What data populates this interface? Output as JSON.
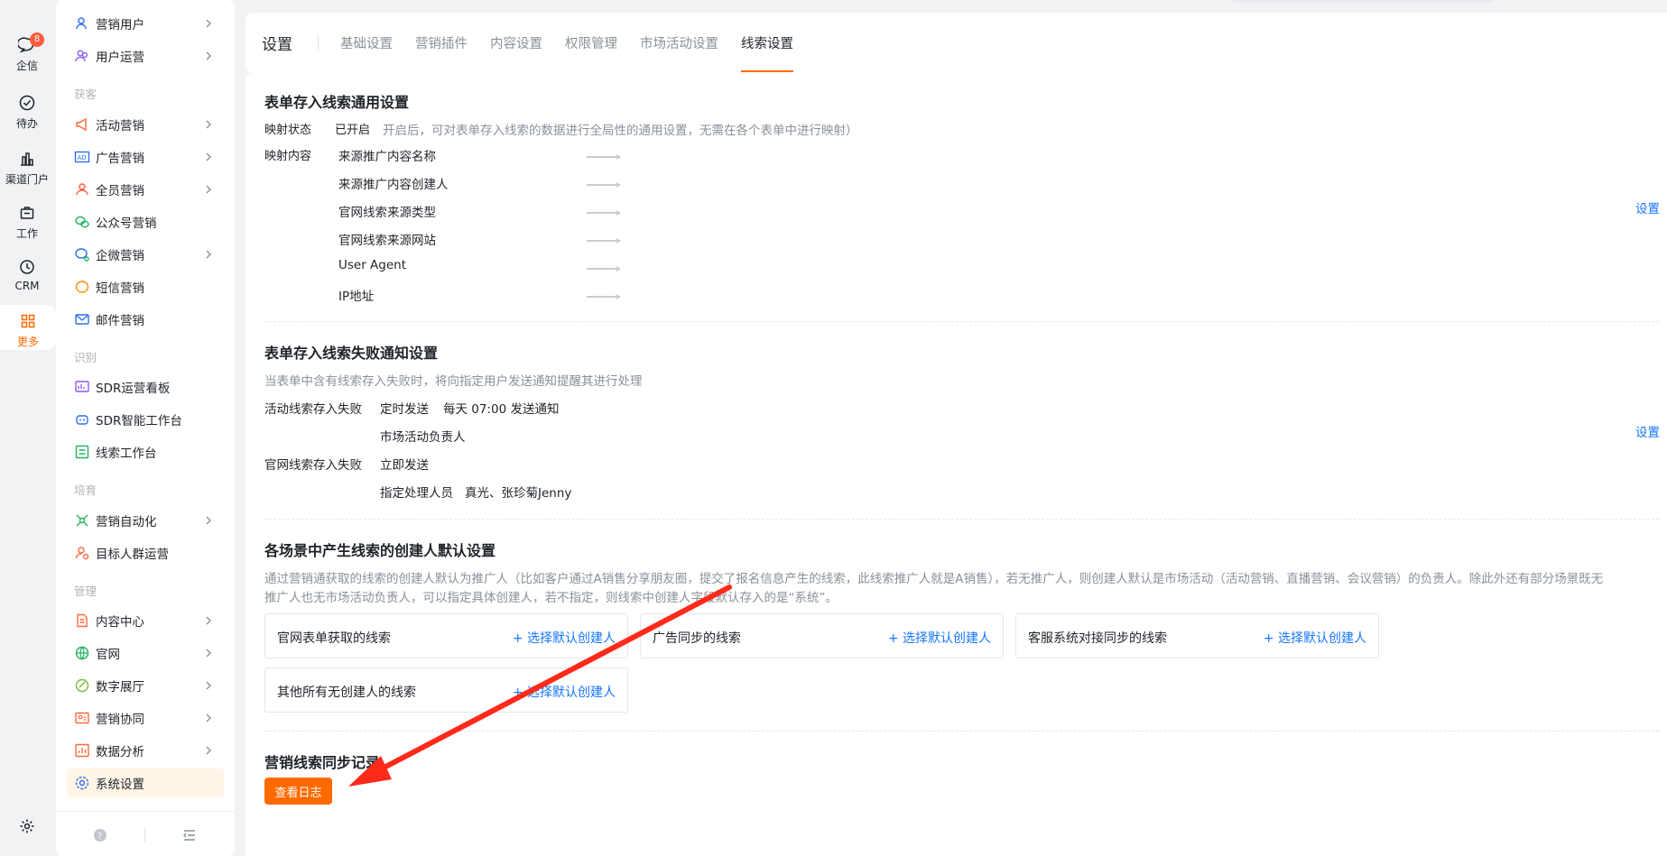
{
  "rail": {
    "items": [
      {
        "label": "企信",
        "badge": "8"
      },
      {
        "label": "待办"
      },
      {
        "label": "渠道门户"
      },
      {
        "label": "工作"
      },
      {
        "label": "CRM"
      },
      {
        "label": "更多"
      }
    ]
  },
  "menu": {
    "items": [
      {
        "label": "营销用户"
      },
      {
        "label": "用户运营"
      },
      {
        "label": "活动营销"
      },
      {
        "label": "广告营销"
      },
      {
        "label": "全员营销"
      },
      {
        "label": "公众号营销"
      },
      {
        "label": "企微营销"
      },
      {
        "label": "短信营销"
      },
      {
        "label": "邮件营销"
      },
      {
        "label": "SDR运营看板"
      },
      {
        "label": "SDR智能工作台"
      },
      {
        "label": "线索工作台"
      },
      {
        "label": "营销自动化"
      },
      {
        "label": "目标人群运营"
      },
      {
        "label": "内容中心"
      },
      {
        "label": "官网"
      },
      {
        "label": "数字展厅"
      },
      {
        "label": "营销协同"
      },
      {
        "label": "数据分析"
      },
      {
        "label": "系统设置"
      }
    ],
    "groups": [
      "获客",
      "识别",
      "培育",
      "管理"
    ]
  },
  "header": {
    "title": "设置",
    "tabs": [
      "基础设置",
      "营销插件",
      "内容设置",
      "权限管理",
      "市场活动设置",
      "线索设置"
    ],
    "active_tab": "线索设置"
  },
  "section1": {
    "title": "表单存入线索通用设置",
    "status_label": "映射状态",
    "status_value": "已开启",
    "status_desc": "开启后，可对表单存入线索的数据进行全局性的通用设置，无需在各个表单中进行映射）",
    "mapping_label": "映射内容",
    "mappings": [
      "来源推广内容名称",
      "来源推广内容创建人",
      "官网线索来源类型",
      "官网线索来源网站",
      "User Agent",
      "IP地址"
    ],
    "settings_link": "设置"
  },
  "section2": {
    "title": "表单存入线索失败通知设置",
    "desc": "当表单中含有线索存入失败时，将向指定用户发送通知提醒其进行处理",
    "activity_label": "活动线索存入失败",
    "activity_mode": "定时发送",
    "activity_schedule": "每天 07:00 发送通知",
    "activity_recipient": "市场活动负责人",
    "website_label": "官网线索存入失败",
    "website_mode": "立即发送",
    "website_recipient_label": "指定处理人员",
    "website_recipients": "真光、张珍菊Jenny",
    "settings_link": "设置"
  },
  "section3": {
    "title": "各场景中产生线索的创建人默认设置",
    "desc_line1": "通过营销通获取的线索的创建人默认为推广人（比如客户通过A销售分享朋友圈，提交了报名信息产生的线索，此线索推广人就是A销售），若无推广人，则创建人默认是市场活动（活动营销、直播营销、会议营销）的负责人。除此外还有部分场景既无",
    "desc_line2": "推广人也无市场活动负责人，可以指定具体创建人，若不指定，则线索中创建人字段默认存入的是“系统”。",
    "cards": [
      {
        "label": "官网表单获取的线索",
        "action": "+ 选择默认创建人"
      },
      {
        "label": "广告同步的线索",
        "action": "+ 选择默认创建人"
      },
      {
        "label": "客服系统对接同步的线索",
        "action": "+ 选择默认创建人"
      },
      {
        "label": "其他所有无创建人的线索",
        "action": "+ 选择默认创建人"
      }
    ]
  },
  "section4": {
    "title": "营销线索同步记录",
    "button": "查看日志"
  },
  "colors": {
    "accent": "#ff6a00",
    "link": "#1677ff",
    "annotation": "#ff2a1a"
  }
}
